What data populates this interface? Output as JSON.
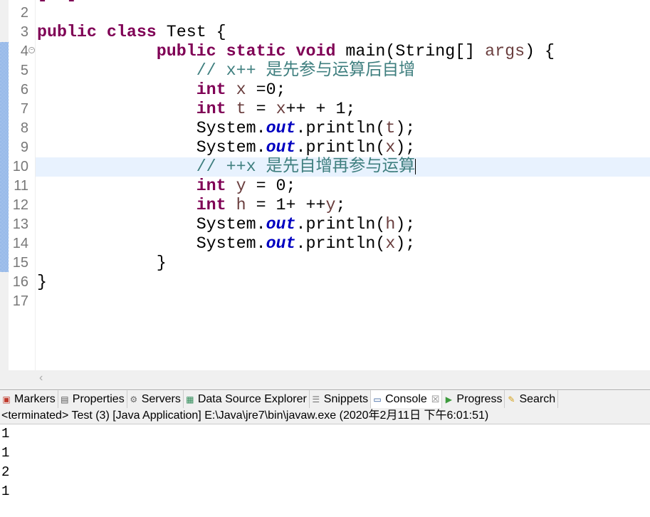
{
  "editor": {
    "lines": [
      {
        "n": "2"
      },
      {
        "n": "3"
      },
      {
        "n": "4"
      },
      {
        "n": "5"
      },
      {
        "n": "6"
      },
      {
        "n": "7"
      },
      {
        "n": "8"
      },
      {
        "n": "9"
      },
      {
        "n": "10"
      },
      {
        "n": "11"
      },
      {
        "n": "12"
      },
      {
        "n": "13"
      },
      {
        "n": "14"
      },
      {
        "n": "15"
      },
      {
        "n": "16"
      },
      {
        "n": "17"
      }
    ],
    "kw_public": "public",
    "kw_class": "class",
    "class_name": " Test {",
    "kw_static": "static",
    "kw_void": "void",
    "main_sig": " main(String[] ",
    "args": "args",
    ") {": ") {",
    "comment1": "// x++ 是先参与运算后自增",
    "comment2": "// ++x 是先自增再参与运算",
    "kw_int": "int",
    "l6_x": "x",
    "l6_rest": " =0;",
    "l7_t": "t",
    "l7_eq": " = ",
    "l7_x": "x",
    "l7_rest": "++ + 1;",
    "sys": "System.",
    "out": "out",
    "println": ".println(",
    "v_t": "t",
    "v_x": "x",
    "v_h": "h",
    "v_y": "y",
    "end": ");",
    "l11_rest": " = 0;",
    "l12_eq": " = 1+ ++",
    "semi": ";",
    "close_method": "}",
    "close_class": "}"
  },
  "tabs": [
    {
      "label": "Markers",
      "icon": "markers-icon"
    },
    {
      "label": "Properties",
      "icon": "properties-icon"
    },
    {
      "label": "Servers",
      "icon": "servers-icon"
    },
    {
      "label": "Data Source Explorer",
      "icon": "data-source-icon"
    },
    {
      "label": "Snippets",
      "icon": "snippets-icon"
    },
    {
      "label": "Console",
      "icon": "console-icon",
      "close": "☒"
    },
    {
      "label": "Progress",
      "icon": "progress-icon"
    },
    {
      "label": "Search",
      "icon": "search-icon"
    }
  ],
  "console": {
    "status": "<terminated> Test (3) [Java Application] E:\\Java\\jre7\\bin\\javaw.exe (2020年2月11日 下午6:01:51)",
    "output": [
      "1",
      "1",
      "2",
      "1"
    ]
  }
}
